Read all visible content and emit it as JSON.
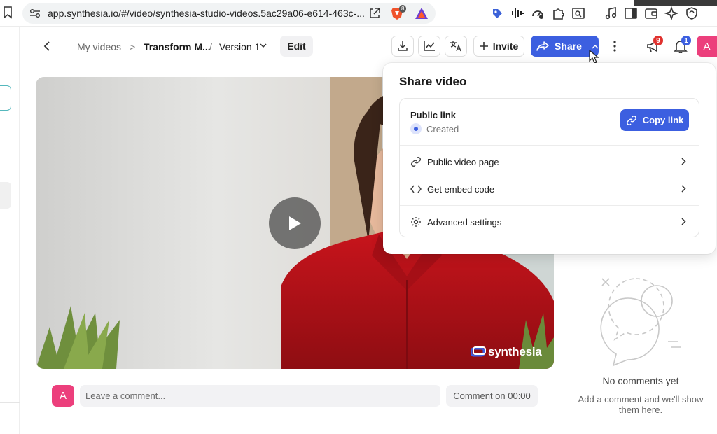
{
  "browser": {
    "url": "app.synthesia.io/#/video/synthesia-studio-videos.5ac29a06-e614-463c-...",
    "brave_badge": "8"
  },
  "header": {
    "breadcrumb_root": "My videos",
    "separator1": ">",
    "video_title": "Transform M...",
    "separator2": "/",
    "version": "Version 1",
    "edit_label": "Edit",
    "invite_label": "Invite",
    "share_label": "Share",
    "announcements_count": "9",
    "notifications_count": "1",
    "avatar_initial": "A"
  },
  "video": {
    "watermark": "synthesia"
  },
  "comments": {
    "avatar_initial": "A",
    "input_placeholder": "Leave a comment...",
    "timestamp_label": "Comment on 00:00",
    "empty_title": "No comments yet",
    "empty_subtitle": "Add a comment and we'll show them here."
  },
  "share_popover": {
    "title": "Share video",
    "public_link_label": "Public link",
    "public_link_status": "Created",
    "copy_link_label": "Copy link",
    "items": [
      {
        "label": "Public video page",
        "icon": "link-icon"
      },
      {
        "label": "Get embed code",
        "icon": "code-icon"
      },
      {
        "label": "Advanced settings",
        "icon": "gear-icon"
      }
    ]
  },
  "colors": {
    "accent": "#3c5fe0",
    "avatar": "#ec3f7c",
    "badge_red": "#e0322f"
  }
}
